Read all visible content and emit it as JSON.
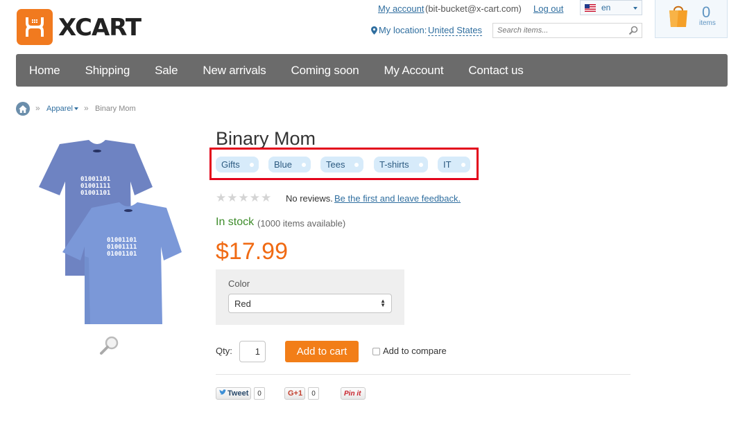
{
  "brand": {
    "name": "XCART"
  },
  "header": {
    "my_account_link": "My account",
    "account_email": "(bit-bucket@x-cart.com)",
    "logout_link": "Log out",
    "location_label": "My location:",
    "location_value": "United States",
    "language": "en",
    "search_placeholder": "Search items...",
    "cart_count": "0",
    "cart_items_label": "items"
  },
  "nav": {
    "items": [
      "Home",
      "Shipping",
      "Sale",
      "New arrivals",
      "Coming soon",
      "My Account",
      "Contact us"
    ]
  },
  "breadcrumb": {
    "separator": "»",
    "category": "Apparel",
    "current": "Binary Mom"
  },
  "product": {
    "title": "Binary Mom",
    "tags": [
      "Gifts",
      "Blue",
      "Tees",
      "T-shirts",
      "IT"
    ],
    "rating_stars": 0,
    "reviews_text": "No reviews.",
    "reviews_link": "Be the first and leave feedback.",
    "stock_status": "In stock",
    "availability": "(1000 items available)",
    "price": "$17.99",
    "option_label": "Color",
    "option_selected": "Red",
    "qty_label": "Qty:",
    "qty_value": "1",
    "add_to_cart_label": "Add to cart",
    "compare_label": "Add to compare",
    "shirt_print": [
      "01001101",
      "01001111",
      "01001101"
    ]
  },
  "social": {
    "tweet_label": "Tweet",
    "tweet_count": "0",
    "gplus_label": "G+1",
    "gplus_count": "0",
    "pinit_label": "Pin it"
  },
  "colors": {
    "accent": "#f27e18",
    "price": "#f06a13",
    "nav_bg": "#6b6b6b",
    "link": "#2f6e9f",
    "in_stock": "#3d8c2a",
    "highlight_border": "#e3051b",
    "tag_bg": "#d7ebfa"
  }
}
